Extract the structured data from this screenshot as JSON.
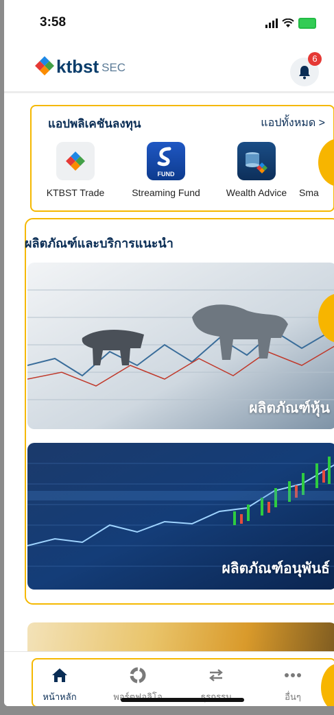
{
  "status": {
    "time": "3:58"
  },
  "header": {
    "logo_text": "ktbst",
    "logo_suffix": "SEC",
    "notification_count": "6"
  },
  "apps": {
    "title": "แอปพลิเคชันลงทุน",
    "see_all": "แอปทั้งหมด >",
    "items": [
      {
        "label": "KTBST Trade",
        "icon": "ktbst-logo-icon"
      },
      {
        "label": "Streaming Fund",
        "icon": "streaming-fund-icon",
        "icon_caption": "FUND"
      },
      {
        "label": "Wealth Advice",
        "icon": "wealth-advice-icon"
      },
      {
        "label": "Sma",
        "icon": "smart-app-icon"
      }
    ]
  },
  "products": {
    "title": "ผลิตภัณฑ์และบริการแนะนำ",
    "cards": [
      {
        "label": "ผลิตภัณฑ์หุ้น"
      },
      {
        "label": "ผลิตภัณฑ์อนุพันธ์"
      }
    ]
  },
  "nav": {
    "items": [
      {
        "label": "หน้าหลัก",
        "icon": "home-icon",
        "active": true
      },
      {
        "label": "พอร์ตฟอลิโอ",
        "icon": "portfolio-icon",
        "active": false
      },
      {
        "label": "ธุรกรรม",
        "icon": "transfer-icon",
        "active": false
      },
      {
        "label": "อื่นๆ",
        "icon": "more-icon",
        "active": false
      }
    ]
  },
  "colors": {
    "navy": "#0a2d55",
    "highlight": "#f5b800",
    "badge": "#e53935",
    "inactive": "#7a7a7a"
  }
}
